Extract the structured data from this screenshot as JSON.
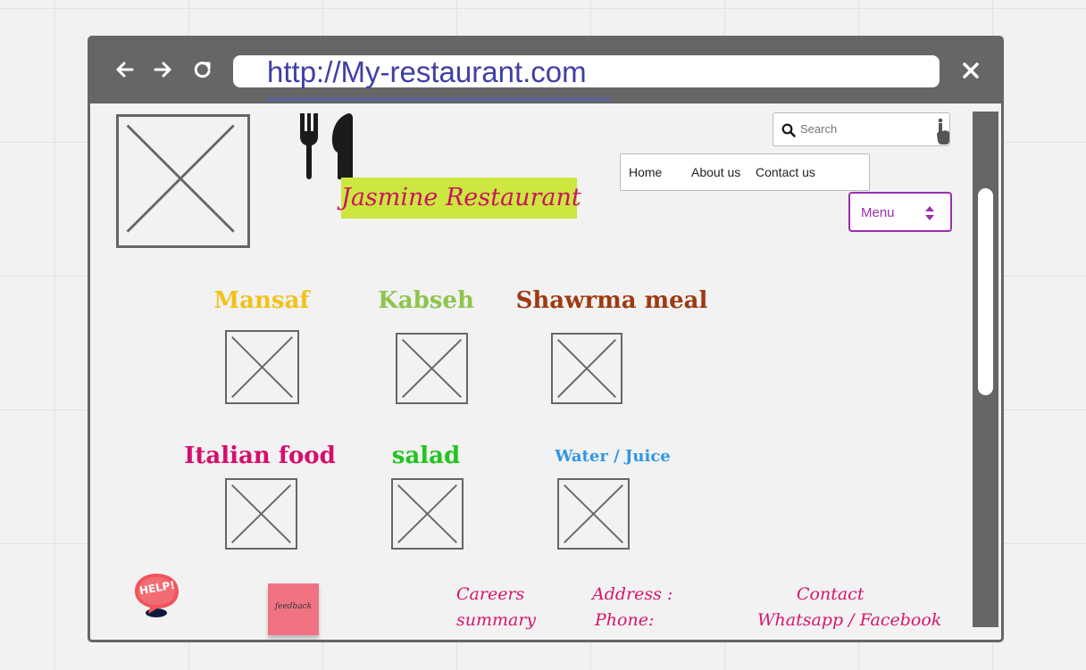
{
  "browser": {
    "url": "http://My-restaurant.com",
    "nav_icons": [
      "back-arrow-icon",
      "forward-arrow-icon",
      "reload-icon"
    ],
    "close_icon": "close-icon"
  },
  "header": {
    "restaurant_name": "Jasmine Restaurant",
    "logo_icon": "fork-knife-icon",
    "name_bg": "#cde640",
    "name_color": "#c8155e"
  },
  "search": {
    "placeholder": "Search"
  },
  "nav": {
    "items": [
      "Home",
      "About us",
      "Contact us"
    ]
  },
  "menu_select": {
    "value": "Menu",
    "color": "#9a2fb0"
  },
  "dishes": [
    {
      "name": "Mansaf",
      "color": "#f2c21a"
    },
    {
      "name": "Kabseh",
      "color": "#8fc44c"
    },
    {
      "name": "Shawrma meal",
      "color": "#9e3a12"
    },
    {
      "name": "Italian food",
      "color": "#d60e6c"
    },
    {
      "name": "salad",
      "color": "#22c41f"
    },
    {
      "name": "Water / Juice",
      "color": "#2f96e8"
    }
  ],
  "footer": {
    "help_label": "HELP!",
    "feedback_label": "feedback",
    "careers": "Careers",
    "summary": "summary",
    "address": "Address  :",
    "phone": "Phone:",
    "contact": "Contact",
    "social": "Whatsapp / Facebook"
  }
}
